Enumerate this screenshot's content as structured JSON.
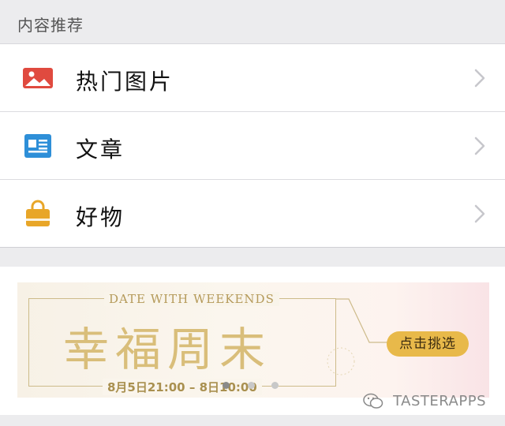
{
  "section": {
    "title": "内容推荐"
  },
  "list": {
    "items": [
      {
        "label": "热门图片",
        "icon": "image-icon",
        "color": "#e04a3f"
      },
      {
        "label": "文章",
        "icon": "article-icon",
        "color": "#2e8fd8"
      },
      {
        "label": "好物",
        "icon": "shopping-bag-icon",
        "color": "#e8a628"
      }
    ]
  },
  "banner": {
    "subtitle": "DATE WITH WEEKENDS",
    "title": "幸福周末",
    "date_range": "8月5日21:00 – 8日10:00",
    "cta_label": "点击挑选",
    "carousel": {
      "count": 3,
      "active": 0
    },
    "colors": {
      "gold": "#d9be7a",
      "cta": "#e8b94a"
    }
  },
  "watermark": {
    "text": "TASTERAPPS"
  }
}
